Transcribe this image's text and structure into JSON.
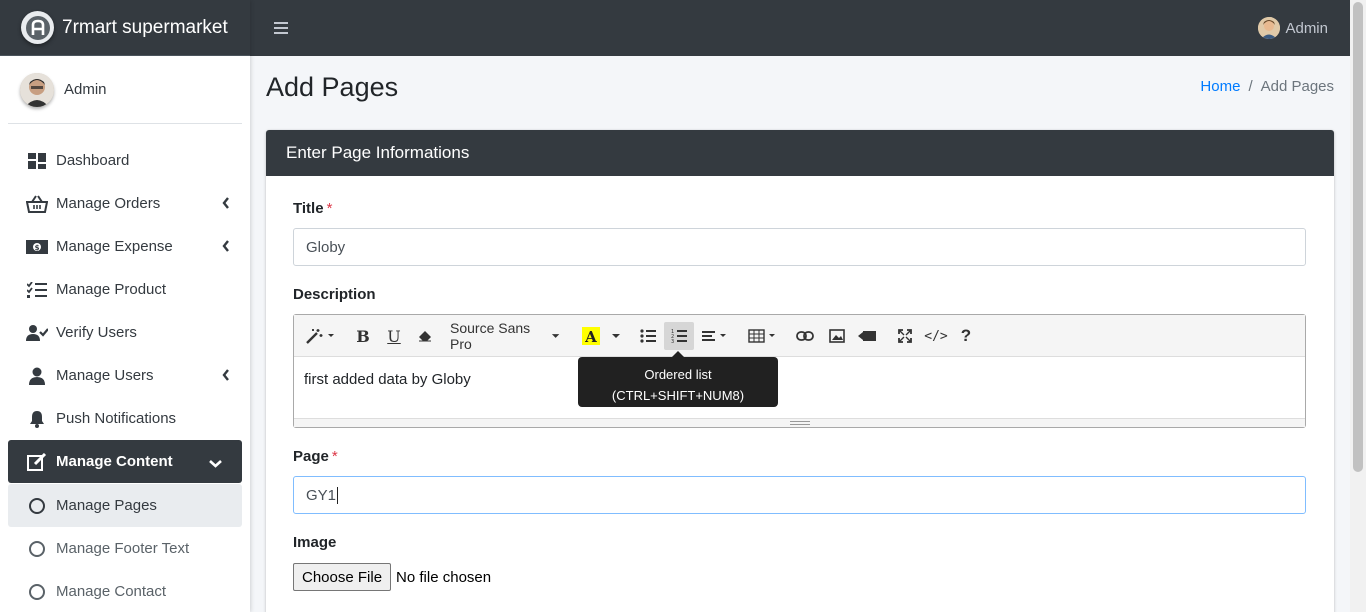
{
  "brand": {
    "name": "7rmart supermarket"
  },
  "sidebar": {
    "user_name": "Admin",
    "items": [
      {
        "label": "Dashboard",
        "icon": "dashboard-icon"
      },
      {
        "label": "Manage Orders",
        "icon": "basket-icon"
      },
      {
        "label": "Manage Expense",
        "icon": "money-icon"
      },
      {
        "label": "Manage Product",
        "icon": "list-check-icon"
      },
      {
        "label": "Verify Users",
        "icon": "user-check-icon"
      },
      {
        "label": "Manage Users",
        "icon": "user-icon"
      },
      {
        "label": "Push Notifications",
        "icon": "bell-icon"
      },
      {
        "label": "Manage Content",
        "icon": "edit-icon"
      },
      {
        "label": "Manage Pages",
        "icon": "circle-icon"
      },
      {
        "label": "Manage Footer Text",
        "icon": "circle-icon"
      },
      {
        "label": "Manage Contact",
        "icon": "circle-icon"
      }
    ]
  },
  "header": {
    "user_name": "Admin"
  },
  "page": {
    "title": "Add Pages",
    "breadcrumb": {
      "home": "Home",
      "separator": "/",
      "current": "Add Pages"
    }
  },
  "card": {
    "title": "Enter Page Informations",
    "title_label": "Title",
    "title_required": "*",
    "title_value": "Globy",
    "description_label": "Description",
    "editor": {
      "font_name": "Source Sans Pro",
      "content": "first added data by Globy",
      "tooltip_line1": "Ordered list",
      "tooltip_line2": "(CTRL+SHIFT+NUM8)"
    },
    "page_label": "Page",
    "page_required": "*",
    "page_value": "GY1",
    "image_label": "Image",
    "file_button": "Choose File",
    "file_status": "No file chosen"
  },
  "colors": {
    "dark": "#343a40",
    "link": "#007bff",
    "required": "#dc3545"
  }
}
